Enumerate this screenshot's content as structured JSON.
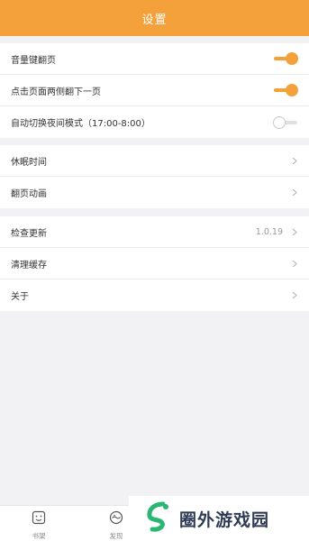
{
  "header": {
    "title": "设置"
  },
  "settings": {
    "group1": [
      {
        "label": "音量键翻页",
        "toggle": "on"
      },
      {
        "label": "点击页面两侧翻下一页",
        "toggle": "on"
      },
      {
        "label": "自动切换夜间模式（17:00-8:00）",
        "toggle": "off"
      }
    ],
    "group2": [
      {
        "label": "休眠时间"
      },
      {
        "label": "翻页动画"
      }
    ],
    "group3": [
      {
        "label": "检查更新",
        "value": "1.0.19"
      },
      {
        "label": "清理缓存"
      },
      {
        "label": "关于"
      }
    ]
  },
  "bottom_nav": {
    "tabs": [
      {
        "label": "书架",
        "icon": "bookshelf-icon"
      },
      {
        "label": "发现",
        "icon": "discover-icon"
      }
    ]
  },
  "watermark": {
    "text": "圈外游戏园"
  },
  "colors": {
    "accent": "#f4a13b",
    "background": "#f2f2f4"
  }
}
